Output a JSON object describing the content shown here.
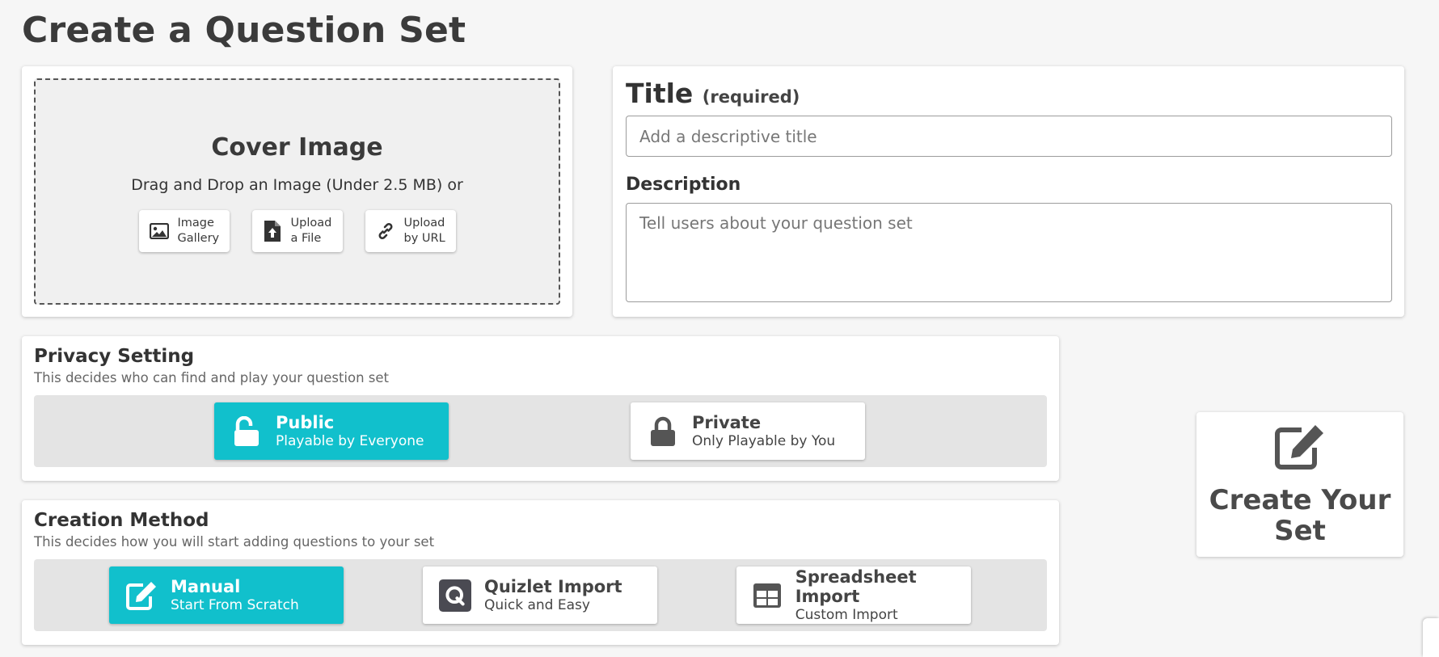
{
  "page": {
    "title": "Create a Question Set"
  },
  "cover": {
    "title": "Cover Image",
    "subtitle": "Drag and Drop an Image (Under 2.5 MB) or",
    "buttons": [
      {
        "line1": "Image",
        "line2": "Gallery",
        "icon": "image-icon"
      },
      {
        "line1": "Upload",
        "line2": "a File",
        "icon": "file-upload-icon"
      },
      {
        "line1": "Upload",
        "line2": "by URL",
        "icon": "link-icon"
      }
    ]
  },
  "form": {
    "title_label": "Title",
    "title_required": "(required)",
    "title_placeholder": "Add a descriptive title",
    "title_value": "",
    "description_label": "Description",
    "description_placeholder": "Tell users about your question set",
    "description_value": ""
  },
  "privacy": {
    "title": "Privacy Setting",
    "description": "This decides who can find and play your question set",
    "selected": "public",
    "options": [
      {
        "title": "Public",
        "subtitle": "Playable by Everyone",
        "icon": "unlock-icon",
        "active": true
      },
      {
        "title": "Private",
        "subtitle": "Only Playable by You",
        "icon": "lock-icon",
        "active": false
      }
    ]
  },
  "method": {
    "title": "Creation Method",
    "description": "This decides how you will start adding questions to your set",
    "selected": "manual",
    "options": [
      {
        "title": "Manual",
        "subtitle": "Start From Scratch",
        "icon": "edit-icon",
        "active": true
      },
      {
        "title": "Quizlet Import",
        "subtitle": "Quick and Easy",
        "icon": "quizlet-icon",
        "active": false
      },
      {
        "title": "Spreadsheet Import",
        "subtitle": "Custom Import",
        "icon": "table-icon",
        "active": false
      }
    ]
  },
  "create": {
    "label": "Create Your Set",
    "icon": "edit-icon"
  },
  "colors": {
    "accent": "#11c0cc",
    "background": "#f6f6f6",
    "text": "#3a3a3a"
  }
}
